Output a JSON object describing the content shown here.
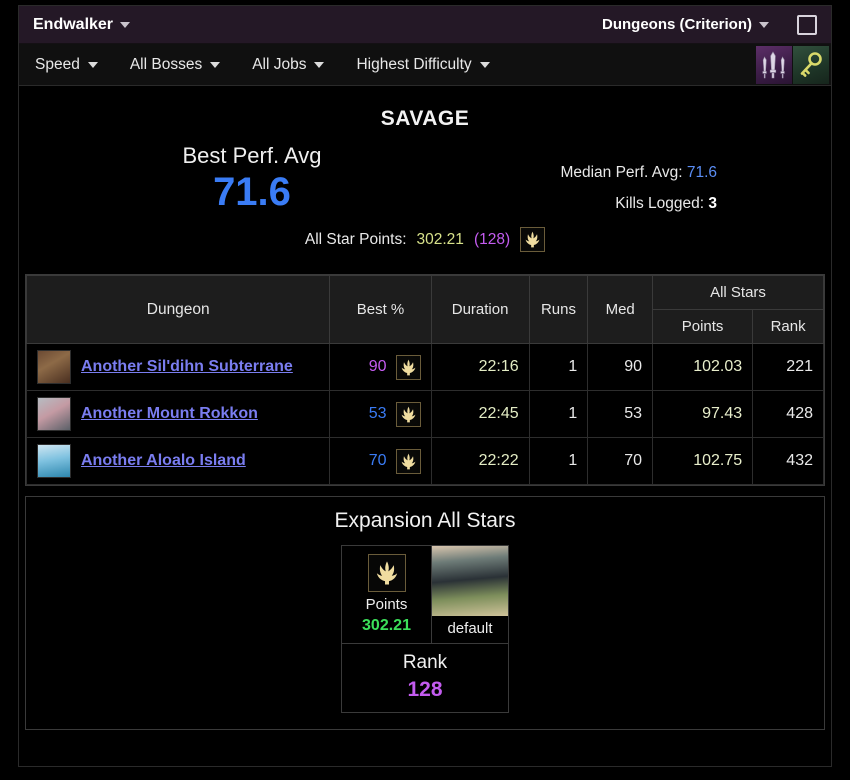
{
  "titlebar": {
    "expansion": "Endwalker",
    "content_type": "Dungeons (Criterion)",
    "window_button": "maximize-icon"
  },
  "filters": [
    {
      "label": "Speed"
    },
    {
      "label": "All Bosses"
    },
    {
      "label": "All Jobs"
    },
    {
      "label": "Highest Difficulty"
    }
  ],
  "badges": [
    {
      "name": "swords-badge"
    },
    {
      "name": "key-badge"
    }
  ],
  "summary": {
    "difficulty": "SAVAGE",
    "best_label": "Best Perf. Avg",
    "best_value": "71.6",
    "median_label": "Median Perf. Avg:",
    "median_value": "71.6",
    "kills_label": "Kills Logged:",
    "kills_value": "3",
    "all_star_label": "All Star Points:",
    "all_star_points": "302.21",
    "all_star_rank": "(128)",
    "colors": {
      "blue": "#3a7cf5",
      "magenta": "#c45cf0",
      "green": "#3ce05a",
      "points_yellow": "#d7e18a"
    }
  },
  "table": {
    "headers": {
      "dungeon": "Dungeon",
      "best": "Best %",
      "duration": "Duration",
      "runs": "Runs",
      "med": "Med",
      "all_stars": "All Stars",
      "points": "Points",
      "rank": "Rank"
    },
    "rows": [
      {
        "name": "Another Sil'dihn Subterrane",
        "best": "90",
        "best_color": "pc-magenta",
        "duration": "22:16",
        "runs": "1",
        "med": "90",
        "med_color": "pc-magenta",
        "points": "102.03",
        "rank": "221",
        "rank_color": "pc-magenta"
      },
      {
        "name": "Another Mount Rokkon",
        "best": "53",
        "best_color": "pc-blue",
        "duration": "22:45",
        "runs": "1",
        "med": "53",
        "med_color": "pc-blue",
        "points": "97.43",
        "rank": "428",
        "rank_color": "pc-green"
      },
      {
        "name": "Another Aloalo Island",
        "best": "70",
        "best_color": "pc-blue",
        "duration": "22:22",
        "runs": "1",
        "med": "70",
        "med_color": "pc-blue",
        "points": "102.75",
        "rank": "432",
        "rank_color": "pc-blue"
      }
    ]
  },
  "expansion": {
    "title": "Expansion All Stars",
    "points_label": "Points",
    "points_value": "302.21",
    "thumb_caption": "default",
    "rank_label": "Rank",
    "rank_value": "128"
  }
}
